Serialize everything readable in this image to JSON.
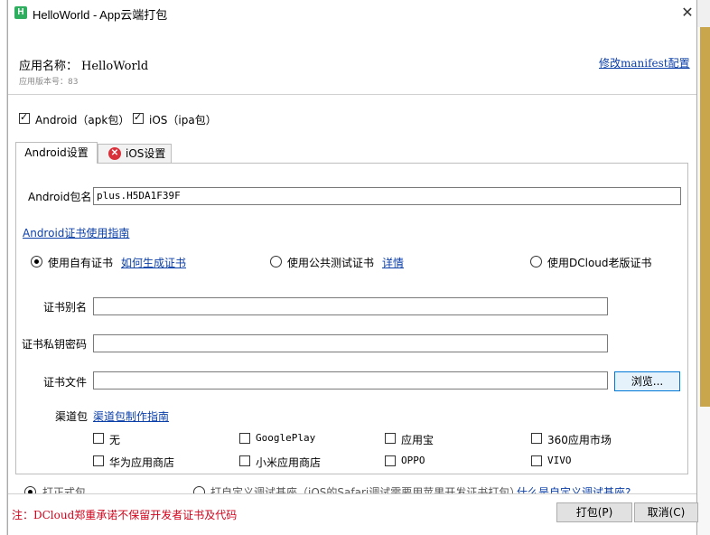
{
  "window": {
    "title": "HelloWorld - App云端打包",
    "logo_text": "H",
    "close_glyph": "✕"
  },
  "app": {
    "name_label": "应用名称：",
    "name_value": "HelloWorld",
    "version_text": "应用版本号：83",
    "manifest_link": "修改manifest配置"
  },
  "platforms": {
    "android_checked": true,
    "android_label": "Android（apk包）",
    "ios_checked": true,
    "ios_label": "iOS（ipa包）"
  },
  "tabs": {
    "android_label": "Android设置",
    "ios_label": "iOS设置",
    "ios_icon": "error-icon"
  },
  "android": {
    "package_label": "Android包名",
    "package_value": "plus.H5DA1F39F",
    "cert_guide_link": "Android证书使用指南",
    "cert_options": [
      {
        "label": "使用自有证书",
        "checked": true
      },
      {
        "label": "使用公共测试证书",
        "checked": false
      },
      {
        "label": "使用DCloud老版证书",
        "checked": false
      }
    ],
    "how_to_generate_link": "如何生成证书",
    "details_link": "详情",
    "alias_label": "证书别名",
    "alias_value": "",
    "password_label": "证书私钥密码",
    "password_value": "",
    "file_label": "证书文件",
    "file_value": "",
    "browse_label": "浏览...",
    "channel_label": "渠道包",
    "channel_guide_link": "渠道包制作指南",
    "channels": [
      {
        "label": "无",
        "checked": false
      },
      {
        "label": "GooglePlay",
        "checked": false
      },
      {
        "label": "应用宝",
        "checked": false
      },
      {
        "label": "360应用市场",
        "checked": false
      },
      {
        "label": "华为应用商店",
        "checked": false
      },
      {
        "label": "小米应用商店",
        "checked": false
      },
      {
        "label": "OPPO",
        "checked": false
      },
      {
        "label": "VIVO",
        "checked": false
      }
    ]
  },
  "bottom": {
    "option1": "打正式包",
    "option2": "打自定义调试基座（iOS的Safari调试需要用苹果开发证书打包）",
    "custom_link": "什么是自定义调试基座?"
  },
  "footer": {
    "note": "注：DCloud郑重承诺不保留开发者证书及代码",
    "pack_button": "打包(P)",
    "cancel_button": "取消(C)"
  }
}
